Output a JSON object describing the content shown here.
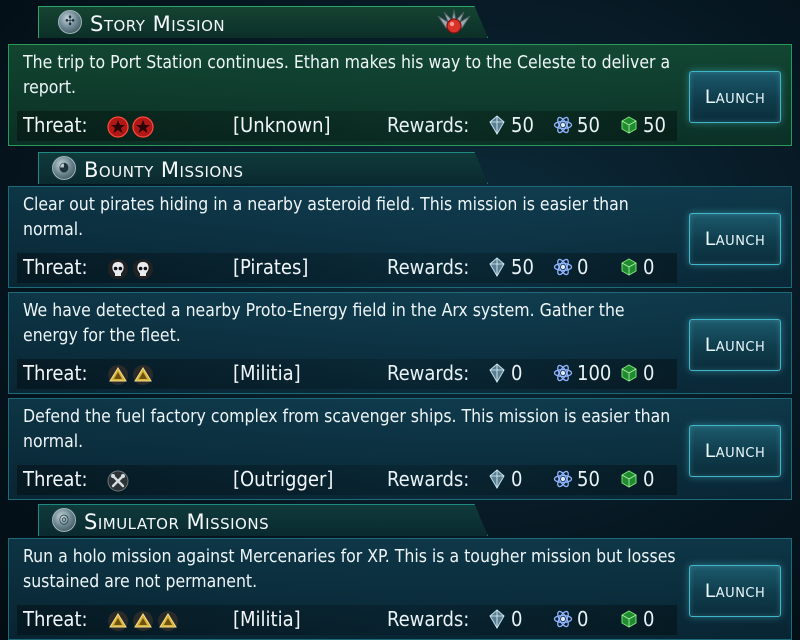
{
  "sections": {
    "story": {
      "title": "Story Mission",
      "icon": "story-mission-icon"
    },
    "bounty": {
      "title": "Bounty Missions",
      "icon": "bounty-mission-icon"
    },
    "simulator": {
      "title": "Simulator Missions",
      "icon": "simulator-mission-icon"
    }
  },
  "labels": {
    "threat": "Threat:",
    "rewards": "Rewards:",
    "launch": "Launch"
  },
  "colors": {
    "story_accent": "#2ea46a",
    "bounty_accent": "#1d6a78",
    "launch_glow": "#3fb7c9"
  },
  "missions": [
    {
      "description": "The trip to Port Station continues.  Ethan makes his way to the Celeste to deliver a report.",
      "threat_icon": "red-star-icon",
      "threat_count": 2,
      "faction": "[Unknown]",
      "rewards": {
        "credits": "50",
        "energy": "50",
        "supplies": "50"
      }
    },
    {
      "description": "Clear out pirates hiding in a nearby asteroid field.  This mission is easier than normal.",
      "threat_icon": "skull-icon",
      "threat_count": 2,
      "faction": "[Pirates]",
      "rewards": {
        "credits": "50",
        "energy": "0",
        "supplies": "0"
      }
    },
    {
      "description": "We have detected a nearby Proto-Energy field in the Arx system.  Gather the energy for the fleet.",
      "threat_icon": "chevron-rank-icon",
      "threat_count": 2,
      "faction": "[Militia]",
      "rewards": {
        "credits": "0",
        "energy": "100",
        "supplies": "0"
      }
    },
    {
      "description": "Defend the fuel factory complex from scavenger ships.  This mission is easier than normal.",
      "threat_icon": "wrench-icon",
      "threat_count": 1,
      "faction": "[Outrigger]",
      "rewards": {
        "credits": "0",
        "energy": "50",
        "supplies": "0"
      }
    },
    {
      "description": "Run a holo mission against Mercenaries for XP.  This is a tougher mission but losses sustained are not permanent.",
      "threat_icon": "chevron-rank-icon",
      "threat_count": 3,
      "faction": "[Militia]",
      "rewards": {
        "credits": "0",
        "energy": "0",
        "supplies": "0"
      }
    }
  ]
}
